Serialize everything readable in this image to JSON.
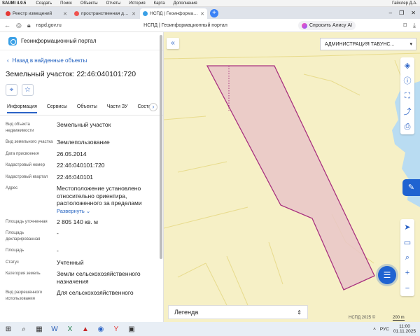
{
  "app_bar": {
    "app_name": "SAUMI 4.9.5",
    "menu": [
      "Создать",
      "Поиск",
      "Объекты",
      "Отчеты",
      "История",
      "Карта",
      "Дополнения"
    ],
    "user": "Гайслер Д.А."
  },
  "tabs": [
    {
      "title": "Реестр извещений",
      "favicon_color": "#e53935",
      "active": false
    },
    {
      "title": "пространственная данн...",
      "favicon_color": "#ef5350",
      "active": false
    },
    {
      "title": "НСПД | Геоинформационн...",
      "favicon_color": "#3aa0e6",
      "active": true
    }
  ],
  "addressbar": {
    "url": "nspd.gov.ru",
    "page_title": "НСПД | Геоинформационный портал",
    "alisa": "Спросить Алису AI"
  },
  "panel": {
    "portal_name": "Геоинформационный портал",
    "back_link": "Назад в найденные объекты",
    "object_title": "Земельный участок: 22:46:040101:720",
    "subtabs": [
      "Информация",
      "Сервисы",
      "Объекты",
      "Части ЗУ",
      "Соста"
    ],
    "active_subtab": "Информация",
    "properties": [
      {
        "key": "Вид объекта недвижимости",
        "value": "Земельный участок"
      },
      {
        "key": "Вид земельного участка",
        "value": "Землепользование"
      },
      {
        "key": "Дата присвоения",
        "value": "26.05.2014"
      },
      {
        "key": "Кадастровый номер",
        "value": "22:46:040101:720"
      },
      {
        "key": "Кадастровый квартал",
        "value": "22:46:040101"
      },
      {
        "key": "Адрес",
        "value": "Местоположение установлено относительно ориентира, расположенного за пределами",
        "link": "Развернуть"
      },
      {
        "key": "Площадь уточненная",
        "value": "2 805 140 кв. м"
      },
      {
        "key": "Площадь декларированная",
        "value": "-"
      },
      {
        "key": "Площадь",
        "value": "-"
      },
      {
        "key": "Статус",
        "value": "Учтенный"
      },
      {
        "key": "Категория земель",
        "value": "Земли сельскохозяйственного назначения"
      },
      {
        "key": "Вид разрешенного использования",
        "value": "Для сельскохозяйственного"
      }
    ]
  },
  "map": {
    "admin_select": "АДМИНИСТРАЦИЯ ТАБУНС...",
    "legend": "Легенда",
    "copyright": "НСПД 2025 ©",
    "scale": "200 m",
    "colors": {
      "land": "#f6f0c6",
      "parcel_fill": "#e9c6c8",
      "parcel_stroke": "#a8327f",
      "water": "#b9dcf2",
      "grid": "#e8db8c"
    },
    "tools_top": [
      "layers-icon",
      "info-icon",
      "frame-icon",
      "share-icon",
      "print-icon"
    ],
    "tools_bottom": [
      "navigate-icon",
      "ruler-icon",
      "search-map-icon",
      "zoom-in-icon",
      "zoom-out-icon"
    ]
  },
  "taskbar": {
    "lang": "РУС",
    "time": "11:00",
    "date": "01.11.2025"
  }
}
